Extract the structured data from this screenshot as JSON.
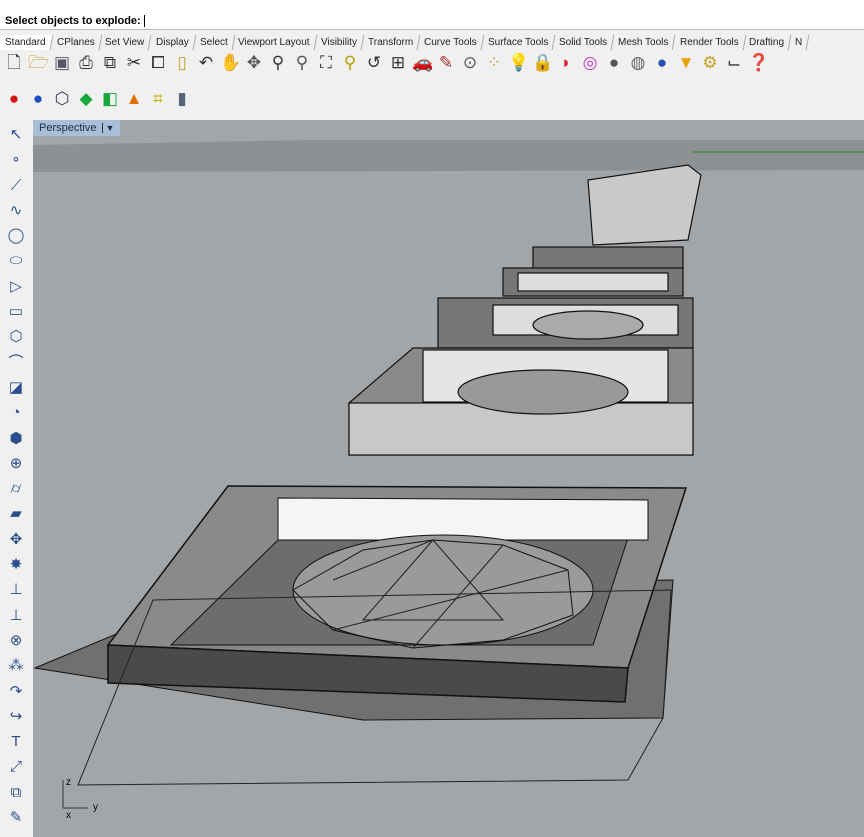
{
  "command": {
    "prompt": "Select objects to explode:"
  },
  "tabs": [
    "Standard",
    "CPlanes",
    "Set View",
    "Display",
    "Select",
    "Viewport Layout",
    "Visibility",
    "Transform",
    "Curve Tools",
    "Surface Tools",
    "Solid Tools",
    "Mesh Tools",
    "Render Tools",
    "Drafting",
    "N"
  ],
  "active_tab": "Standard",
  "toolbar_standard": [
    {
      "icon": "new-file-icon",
      "g": "🗋",
      "c": "#333"
    },
    {
      "icon": "open-folder-icon",
      "g": "🗁",
      "c": "#c9a227"
    },
    {
      "icon": "save-icon",
      "g": "▣",
      "c": "#556"
    },
    {
      "icon": "print-icon",
      "g": "⎙",
      "c": "#333"
    },
    {
      "icon": "import-icon",
      "g": "⧉",
      "c": "#333"
    },
    {
      "icon": "cut-icon",
      "g": "✂",
      "c": "#333"
    },
    {
      "icon": "copy-icon",
      "g": "⧠",
      "c": "#333"
    },
    {
      "icon": "paste-icon",
      "g": "▯",
      "c": "#c9a227"
    },
    {
      "icon": "undo-icon",
      "g": "↶",
      "c": "#333"
    },
    {
      "icon": "pan-hand-icon",
      "g": "✋",
      "c": "#333"
    },
    {
      "icon": "rotate-view-icon",
      "g": "✥",
      "c": "#555"
    },
    {
      "icon": "zoom-icon",
      "g": "⚲",
      "c": "#333"
    },
    {
      "icon": "zoom-window-icon",
      "g": "⚲",
      "c": "#555"
    },
    {
      "icon": "zoom-extents-icon",
      "g": "⛶",
      "c": "#333"
    },
    {
      "icon": "zoom-selected-icon",
      "g": "⚲",
      "c": "#b8a000"
    },
    {
      "icon": "undo-view-icon",
      "g": "↺",
      "c": "#333"
    },
    {
      "icon": "four-viewports-icon",
      "g": "⊞",
      "c": "#333"
    },
    {
      "icon": "car-icon",
      "g": "🚗",
      "c": "#c22"
    },
    {
      "icon": "grid-snap-icon",
      "g": "✎",
      "c": "#a33"
    },
    {
      "icon": "osnap-icon",
      "g": "⊙",
      "c": "#555"
    },
    {
      "icon": "select-points-icon",
      "g": "⁘",
      "c": "#c9a227"
    },
    {
      "icon": "light-icon",
      "g": "💡",
      "c": "#666"
    },
    {
      "icon": "lock-icon",
      "g": "🔒",
      "c": "#333"
    },
    {
      "icon": "shaded-icon",
      "g": "◗",
      "c": "#d23"
    },
    {
      "icon": "color-wheel-icon",
      "g": "◎",
      "c": "#c3c"
    },
    {
      "icon": "sphere-icon",
      "g": "●",
      "c": "#555"
    },
    {
      "icon": "sphere-render-icon",
      "g": "◍",
      "c": "#666"
    },
    {
      "icon": "render-sphere-icon",
      "g": "●",
      "c": "#2450b0"
    },
    {
      "icon": "spotlight-icon",
      "g": "▼",
      "c": "#e8a000"
    },
    {
      "icon": "options-gear-icon",
      "g": "⚙",
      "c": "#c9a227"
    },
    {
      "icon": "dimension-icon",
      "g": "⌙",
      "c": "#333"
    },
    {
      "icon": "help-icon",
      "g": "❓",
      "c": "#2450b0"
    }
  ],
  "toolbar_secondary": [
    {
      "icon": "red-sphere-icon",
      "g": "●",
      "c": "#d01818"
    },
    {
      "icon": "blue-sphere-icon",
      "g": "●",
      "c": "#1e4fc0"
    },
    {
      "icon": "wire-sphere-icon",
      "g": "⬡",
      "c": "#335"
    },
    {
      "icon": "green-shape-icon",
      "g": "◆",
      "c": "#16a83a"
    },
    {
      "icon": "green-box-icon",
      "g": "◧",
      "c": "#16a83a"
    },
    {
      "icon": "cone-icon",
      "g": "▲",
      "c": "#e07000"
    },
    {
      "icon": "control-points-icon",
      "g": "⌗",
      "c": "#c9b000"
    },
    {
      "icon": "cylinder-icon",
      "g": "▮",
      "c": "#567"
    }
  ],
  "left_toolbar": [
    {
      "icon": "select-arrow-icon",
      "g": "↖"
    },
    {
      "icon": "point-icon",
      "g": "∘"
    },
    {
      "icon": "polyline-icon",
      "g": "⟋"
    },
    {
      "icon": "curve-icon",
      "g": "∿"
    },
    {
      "icon": "circle-icon",
      "g": "◯"
    },
    {
      "icon": "ellipse-icon",
      "g": "⬭"
    },
    {
      "icon": "polygon-icon",
      "g": "▷"
    },
    {
      "icon": "rectangle-icon",
      "g": "▭"
    },
    {
      "icon": "polygon-center-icon",
      "g": "⬡"
    },
    {
      "icon": "fillet-curve-icon",
      "g": "⌒"
    },
    {
      "icon": "surface-icon",
      "g": "◪"
    },
    {
      "icon": "surface-revolve-icon",
      "g": "◔"
    },
    {
      "icon": "box-icon",
      "g": "⬢"
    },
    {
      "icon": "solid-union-icon",
      "g": "⊕"
    },
    {
      "icon": "cylinder-solid-icon",
      "g": "⌭"
    },
    {
      "icon": "mesh-icon",
      "g": "▰"
    },
    {
      "icon": "transform-icon",
      "g": "✥"
    },
    {
      "icon": "explode-icon",
      "g": "✸"
    },
    {
      "icon": "extend-icon",
      "g": "⊥"
    },
    {
      "icon": "trim-icon",
      "g": "⊥"
    },
    {
      "icon": "group-icon",
      "g": "⊗"
    },
    {
      "icon": "array-icon",
      "g": "⁂"
    },
    {
      "icon": "offset-icon",
      "g": "↷"
    },
    {
      "icon": "blend-icon",
      "g": "↪"
    },
    {
      "icon": "text-icon",
      "g": "T"
    },
    {
      "icon": "dimension-vertical-icon",
      "g": "⤢"
    },
    {
      "icon": "block-icon",
      "g": "⧉"
    },
    {
      "icon": "properties-icon",
      "g": "✎"
    }
  ],
  "viewport": {
    "title": "Perspective",
    "axis_labels": {
      "z": "z",
      "x": "x",
      "y": "y"
    }
  },
  "colors": {
    "viewport_bg": "#a3a6a9",
    "viewport_title_bg": "#a9bfd8",
    "x_axis": "#2a8a2a"
  }
}
